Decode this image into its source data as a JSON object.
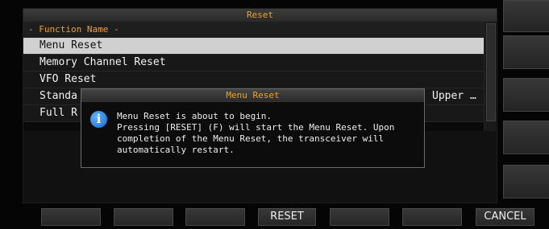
{
  "screen": {
    "title": "Reset",
    "column_header": "- Function Name -",
    "rows": [
      {
        "label": "Menu Reset",
        "value": "",
        "selected": true
      },
      {
        "label": "Memory Channel Reset",
        "value": ""
      },
      {
        "label": "VFO Reset",
        "value": ""
      },
      {
        "label": "Standa",
        "value": "Upper …"
      },
      {
        "label": "Full R",
        "value": ""
      }
    ]
  },
  "dialog": {
    "title": "Menu Reset",
    "icon": "info-icon",
    "line1": "Menu Reset is about to begin.",
    "line2": "Pressing [RESET] (F) will start the Menu Reset. Upon",
    "line3": "completion of the Menu Reset, the transceiver will",
    "line4": "automatically restart."
  },
  "softkeys": [
    "",
    "",
    "",
    "RESET",
    "",
    "",
    "CANCEL"
  ],
  "colors": {
    "accent": "#f0a020",
    "selected_row": "#d0d0d0",
    "background": "#000000"
  }
}
